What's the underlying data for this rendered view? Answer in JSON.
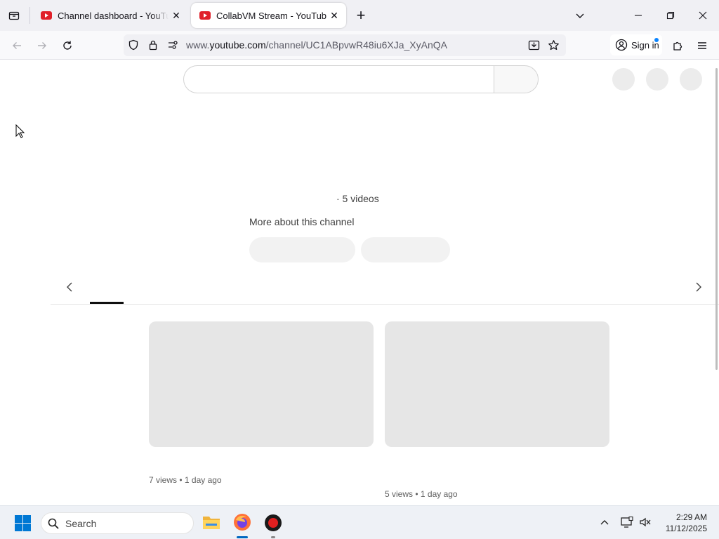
{
  "browser": {
    "tabs": [
      {
        "title": "Channel dashboard - YouTube Studio",
        "close": "✕"
      },
      {
        "title": "CollabVM Stream - YouTube",
        "close": "✕"
      }
    ],
    "new_tab": "+",
    "url_gray_prefix": "www.",
    "url_domain": "youtube.com",
    "url_path": "/channel/UC1ABpvwR48iu6XJa_XyAnQA",
    "sign_in": "Sign in"
  },
  "channel": {
    "video_count": "· 5 videos",
    "more_about": "More about this channel"
  },
  "videos": [
    {
      "meta": "7 views • 1 day ago"
    },
    {
      "meta": "5 views • 1 day ago"
    }
  ],
  "taskbar": {
    "search_placeholder": "Search",
    "time": "2:29 AM",
    "date": "11/12/2025"
  },
  "colors": {
    "youtube_red": "#e0202a",
    "firefox_orange": "#ff7139",
    "windows_blue": "#0078d4"
  }
}
